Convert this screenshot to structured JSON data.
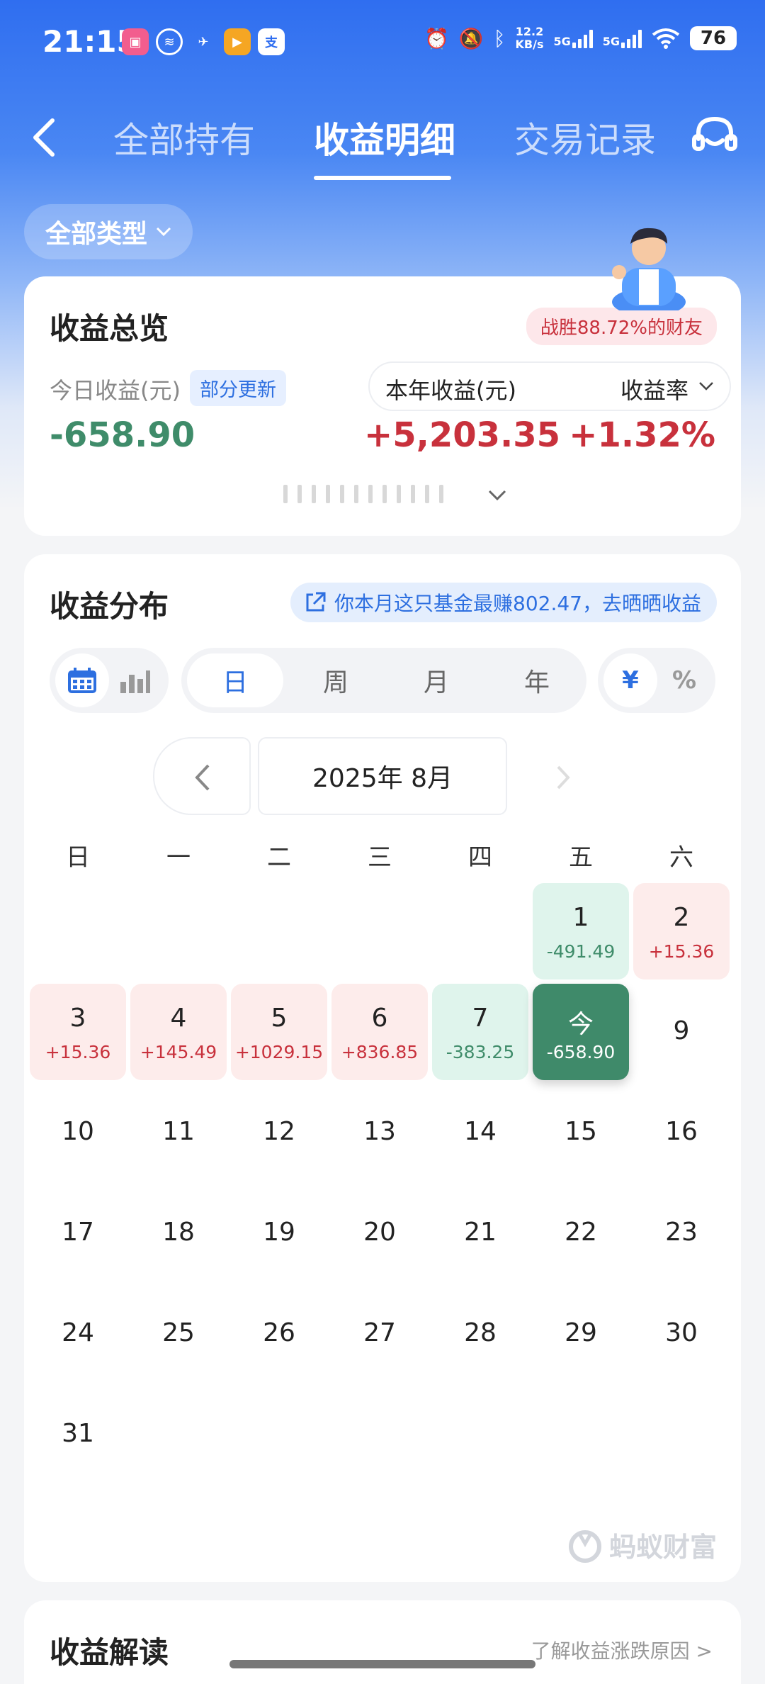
{
  "status_bar": {
    "time": "21:15",
    "net_speed_value": "12.2",
    "net_speed_unit": "KB/s",
    "signal1": "5G",
    "signal2": "5G",
    "battery": "76"
  },
  "header": {
    "tabs": [
      {
        "label": "全部持有"
      },
      {
        "label": "收益明细"
      },
      {
        "label": "交易记录"
      }
    ],
    "active_tab": 1
  },
  "filter": {
    "type_label": "全部类型"
  },
  "overview": {
    "title": "收益总览",
    "victory_badge": "战胜88.72%的财友",
    "today_label": "今日收益(元)",
    "partial_badge": "部分更新",
    "today_value": "-658.90",
    "year_label": "本年收益(元)",
    "rate_label": "收益率",
    "year_value": "+5,203.35",
    "rate_value": "+1.32%"
  },
  "distribution": {
    "title": "收益分布",
    "share_banner": "你本月这只基金最赚802.47，去晒晒收益",
    "periods": [
      "日",
      "周",
      "月",
      "年"
    ],
    "active_period": 0,
    "units": [
      "¥",
      "%"
    ],
    "active_unit": 0,
    "month_label": "2025年 8月",
    "weekdays": [
      "日",
      "一",
      "二",
      "三",
      "四",
      "五",
      "六"
    ],
    "days": [
      {
        "num": "1",
        "val": "-491.49",
        "state": "loss"
      },
      {
        "num": "2",
        "val": "+15.36",
        "state": "gain"
      },
      {
        "num": "3",
        "val": "+15.36",
        "state": "gain"
      },
      {
        "num": "4",
        "val": "+145.49",
        "state": "gain"
      },
      {
        "num": "5",
        "val": "+1029.15",
        "state": "gain"
      },
      {
        "num": "6",
        "val": "+836.85",
        "state": "gain"
      },
      {
        "num": "7",
        "val": "-383.25",
        "state": "loss"
      },
      {
        "num": "今",
        "val": "-658.90",
        "state": "today"
      },
      {
        "num": "9"
      },
      {
        "num": "10"
      },
      {
        "num": "11"
      },
      {
        "num": "12"
      },
      {
        "num": "13"
      },
      {
        "num": "14"
      },
      {
        "num": "15"
      },
      {
        "num": "16"
      },
      {
        "num": "17"
      },
      {
        "num": "18"
      },
      {
        "num": "19"
      },
      {
        "num": "20"
      },
      {
        "num": "21"
      },
      {
        "num": "22"
      },
      {
        "num": "23"
      },
      {
        "num": "24"
      },
      {
        "num": "25"
      },
      {
        "num": "26"
      },
      {
        "num": "27"
      },
      {
        "num": "28"
      },
      {
        "num": "29"
      },
      {
        "num": "30"
      },
      {
        "num": "31"
      }
    ],
    "watermark": "蚂蚁财富"
  },
  "next_section": {
    "title": "收益解读",
    "link": "了解收益涨跌原因 >"
  },
  "colors": {
    "brand_blue": "#2f6ef0",
    "gain_red": "#c8313c",
    "loss_green": "#3f8c6a"
  }
}
